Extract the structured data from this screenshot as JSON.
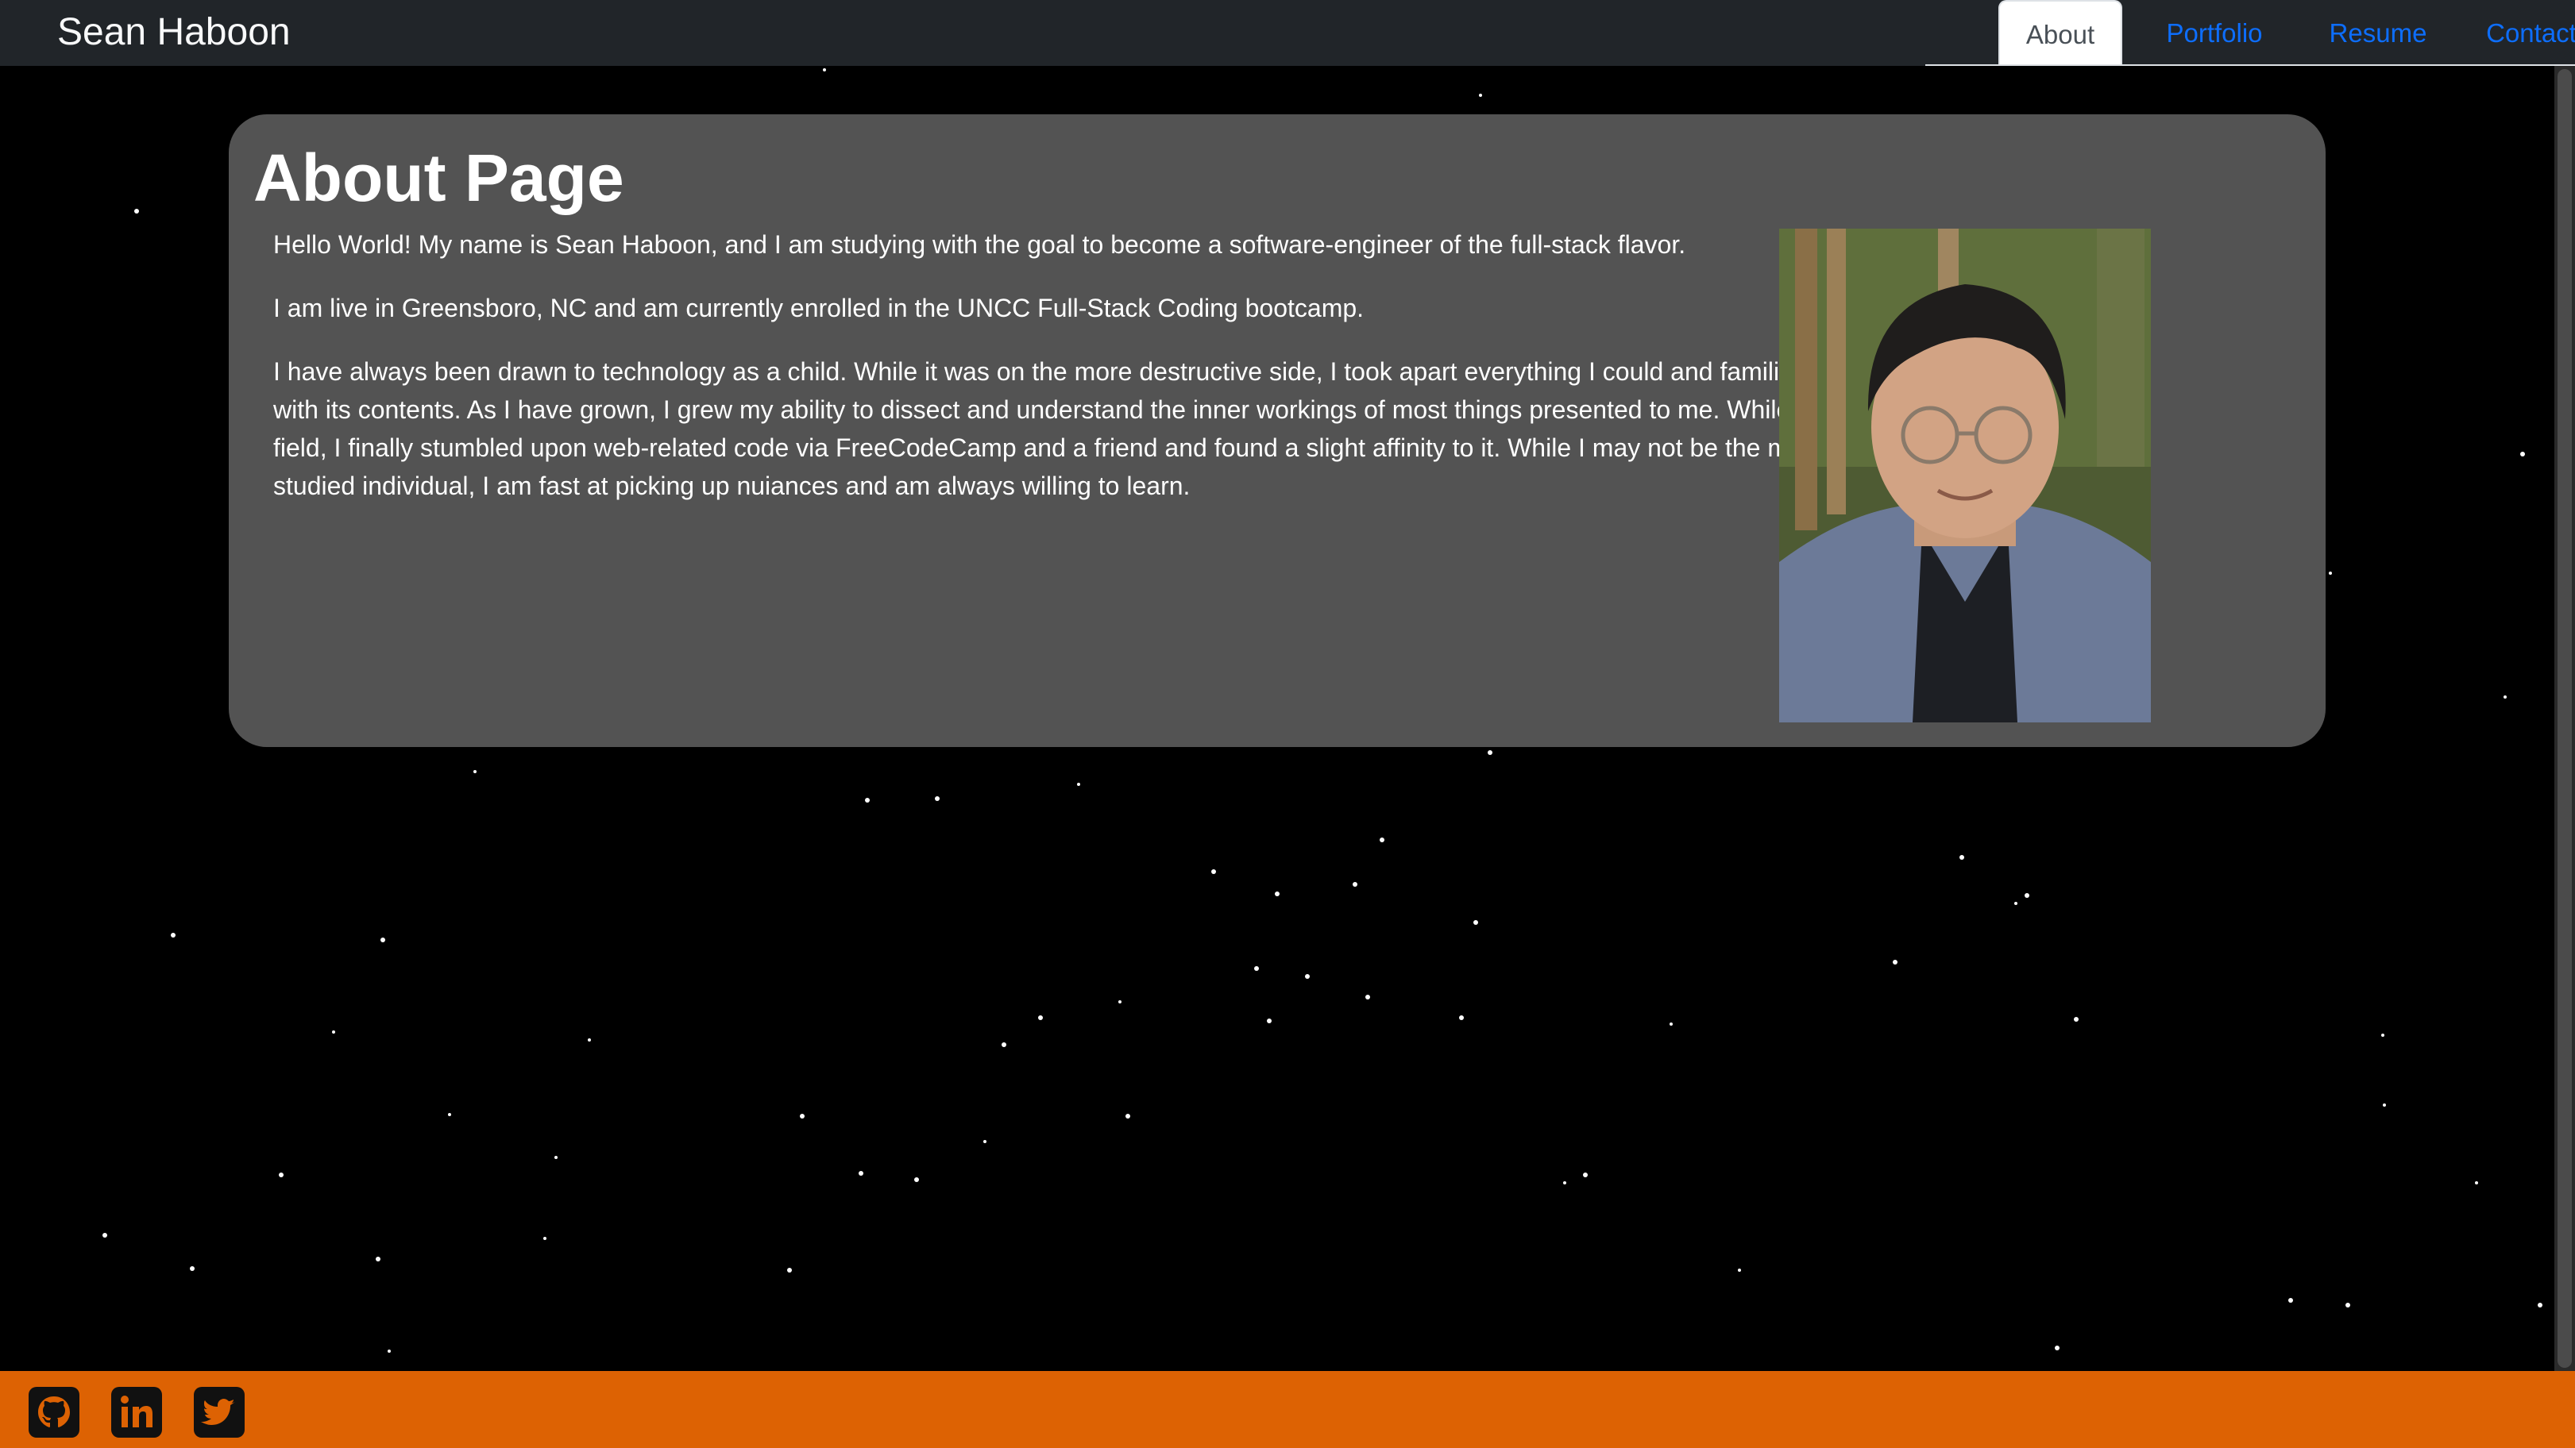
{
  "navbar": {
    "brand": "Sean Haboon",
    "tabs": [
      {
        "label": "About",
        "active": true
      },
      {
        "label": "Portfolio",
        "active": false
      },
      {
        "label": "Resume",
        "active": false
      },
      {
        "label": "Contact",
        "active": false
      }
    ]
  },
  "about": {
    "title": "About Page",
    "paragraphs": [
      "Hello World! My name is Sean Haboon, and I am studying with the goal to become a software-engineer of the full-stack flavor.",
      "I am live in Greensboro, NC and am currently enrolled in the UNCC Full-Stack Coding bootcamp.",
      "I have always been drawn to technology as a child. While it was on the more destructive side, I took apart everything I could and familiarized myself with its contents. As I have grown, I grew my ability to dissect and understand the inner workings of most things presented to me. While late to the field, I finally stumbled upon web-related code via FreeCodeCamp and a friend and found a slight affinity to it. While I may not be the most well-studied individual, I am fast at picking up nuiances and am always willing to learn."
    ],
    "portrait_subject": "profile-photo"
  },
  "footer": {
    "icons": [
      "github-icon",
      "linkedin-icon",
      "twitter-icon"
    ]
  },
  "colors": {
    "navbar_bg": "#212529",
    "card_bg": "#535353",
    "footer_bg": "#dd6203",
    "link": "#0d6efd",
    "page_bg": "#000000"
  }
}
